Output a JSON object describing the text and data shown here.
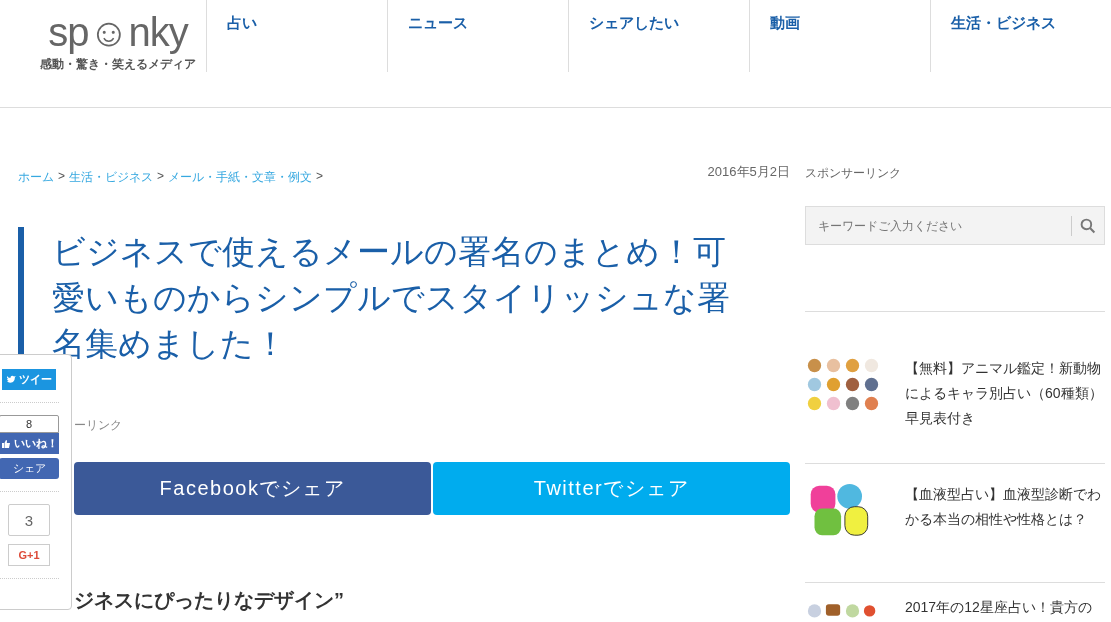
{
  "logo": {
    "name": "sp☺nky",
    "tagline": "感動・驚き・笑えるメディア"
  },
  "nav": [
    {
      "label": "占い"
    },
    {
      "label": "ニュース"
    },
    {
      "label": "シェアしたい"
    },
    {
      "label": "動画"
    },
    {
      "label": "生活・ビジネス"
    }
  ],
  "breadcrumb": [
    {
      "label": "ホーム"
    },
    {
      "label": "生活・ビジネス"
    },
    {
      "label": "メール・手紙・文章・例文"
    }
  ],
  "breadcrumb_separator": ">",
  "date": "2016年5月2日",
  "title": "ビジネスで使えるメールの署名のまとめ！可愛いものからシンプルでスタイリッシュな署名集めました！",
  "sponsor_fragment": "ーリンク",
  "share_buttons": [
    {
      "kind": "facebook",
      "label": "Facebookでシェア"
    },
    {
      "kind": "twitter",
      "label": "Twitterでシェア"
    }
  ],
  "section_heading": "ジネスにぴったりなデザイン”",
  "share_panel": {
    "tweet": "ツイー",
    "like_count": "8",
    "like": "いいね！",
    "share": "シェア",
    "plus_count": "3",
    "plus": "G+1"
  },
  "sidebar": {
    "sponsor_label": "スポンサーリンク",
    "search": {
      "placeholder": "キーワードご入力ください"
    },
    "articles": [
      {
        "kind": "animals",
        "title": "【無料】アニマル鑑定！新動物によるキャラ別占い（60種類）早見表付き"
      },
      {
        "kind": "blood",
        "title": "【血液型占い】血液型診断でわかる本当の相性や性格とは？"
      },
      {
        "kind": "zodiac",
        "title": "2017年の12星座占い！貴方の"
      }
    ]
  }
}
